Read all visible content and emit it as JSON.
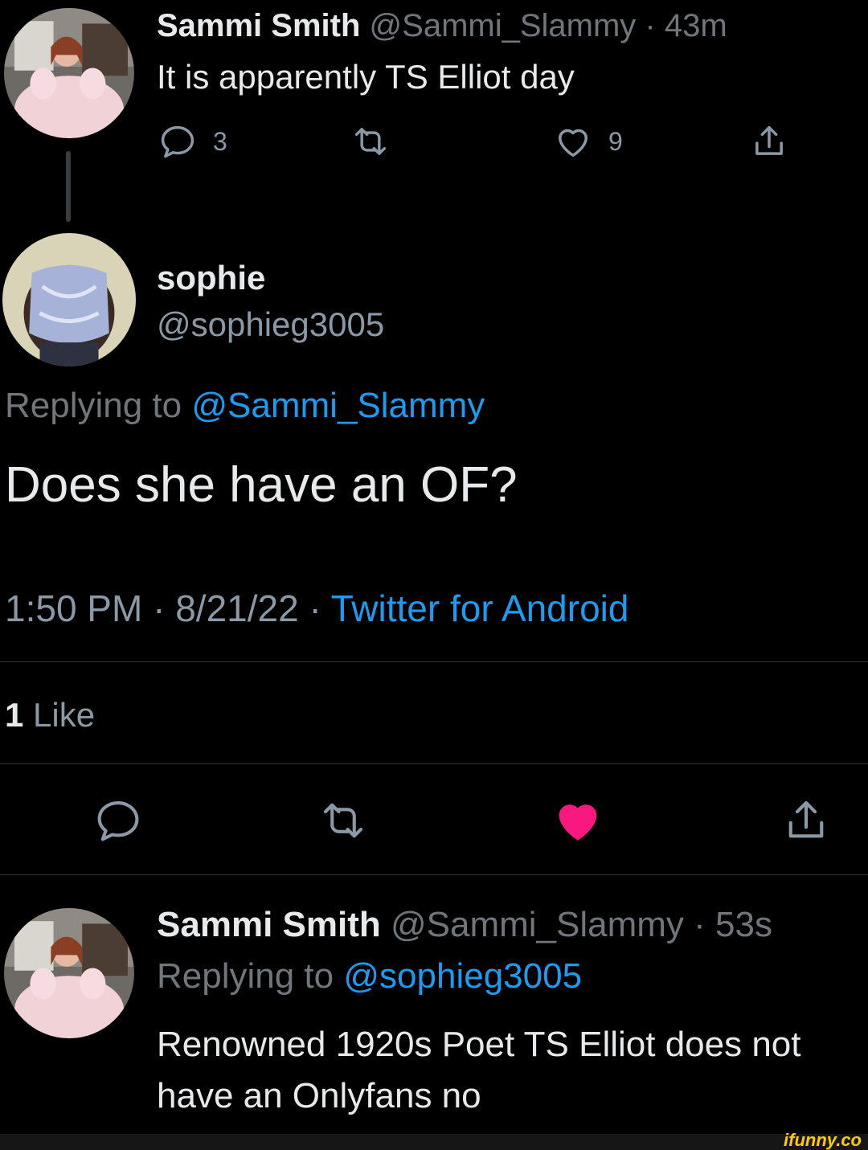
{
  "tweet1": {
    "name": "Sammi Smith",
    "handle": "@Sammi_Slammy",
    "separator": "·",
    "time": "43m",
    "text": "It is apparently TS Elliot day",
    "reply_count": "3",
    "like_count": "9",
    "icons": [
      "reply-icon",
      "retweet-icon",
      "heart-icon",
      "share-icon"
    ]
  },
  "main_tweet": {
    "name": "sophie",
    "handle": "@sophieg3005",
    "replying_prefix": "Replying to",
    "replying_handle": "@Sammi_Slammy",
    "text": "Does she have an OF?",
    "time": "1:50 PM",
    "date": "8/21/22",
    "source": "Twitter for Android",
    "separator": "·",
    "likes_count": "1",
    "likes_label": "Like",
    "liked": true,
    "icons": [
      "reply-icon",
      "retweet-icon",
      "heart-filled-icon",
      "share-icon"
    ]
  },
  "reply": {
    "name": "Sammi Smith",
    "handle": "@Sammi_Slammy",
    "separator": "·",
    "time": "53s",
    "replying_prefix": "Replying to",
    "replying_handle": "@sophieg3005",
    "text": "Renowned 1920s Poet TS Elliot does not have an Onlyfans no"
  },
  "watermark": "ifunny.co",
  "colors": {
    "background": "#000000",
    "text": "#e7e9ea",
    "muted": "#71767b",
    "link": "#1d9bf0",
    "like": "#f91880",
    "divider": "#2f3336"
  }
}
